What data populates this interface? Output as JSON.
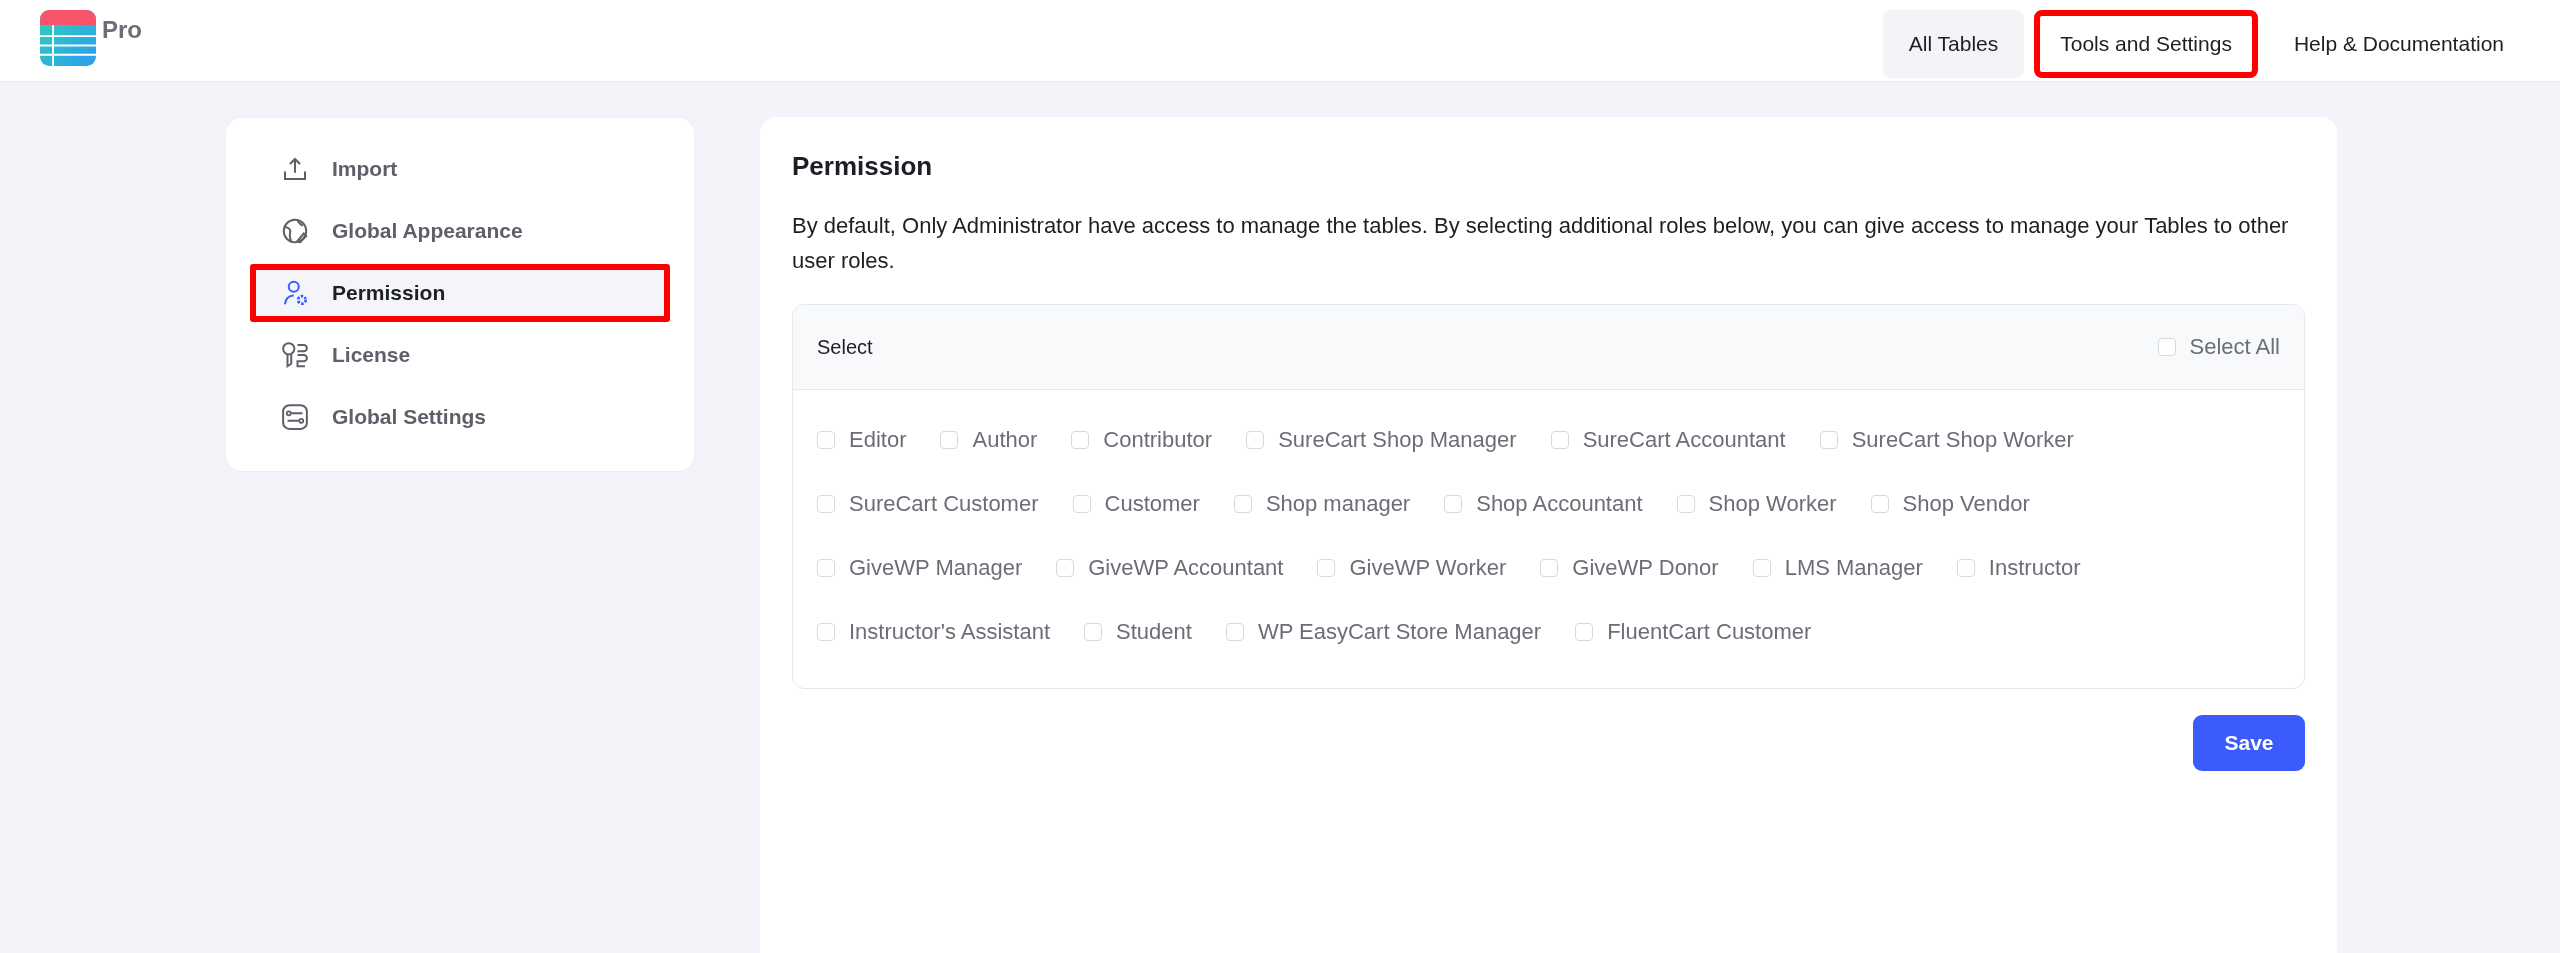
{
  "header": {
    "logo_text": "Pro",
    "nav": [
      {
        "label": "All Tables",
        "selected": true,
        "highlighted": false
      },
      {
        "label": "Tools and Settings",
        "selected": false,
        "highlighted": true
      },
      {
        "label": "Help & Documentation",
        "selected": false,
        "highlighted": false
      }
    ]
  },
  "sidebar": {
    "items": [
      {
        "label": "Import",
        "kind": "import",
        "selected": false,
        "highlighted": false
      },
      {
        "label": "Global Appearance",
        "kind": "appearance",
        "selected": false,
        "highlighted": false
      },
      {
        "label": "Permission",
        "kind": "permission",
        "selected": true,
        "highlighted": true
      },
      {
        "label": "License",
        "kind": "license",
        "selected": false,
        "highlighted": false
      },
      {
        "label": "Global Settings",
        "kind": "settings",
        "selected": false,
        "highlighted": false
      }
    ]
  },
  "panel": {
    "title": "Permission",
    "description": "By default, Only Administrator have access to manage the tables. By selecting additional roles below, you can give access to manage your Tables to other user roles.",
    "select_label": "Select",
    "select_all": {
      "label": "Select All",
      "checked": false
    },
    "role_rows": [
      [
        {
          "label": "Editor",
          "checked": false
        },
        {
          "label": "Author",
          "checked": false
        },
        {
          "label": "Contributor",
          "checked": false
        },
        {
          "label": "SureCart Shop Manager",
          "checked": false
        },
        {
          "label": "SureCart Accountant",
          "checked": false
        },
        {
          "label": "SureCart Shop Worker",
          "checked": false
        }
      ],
      [
        {
          "label": "SureCart Customer",
          "checked": false
        },
        {
          "label": "Customer",
          "checked": false
        },
        {
          "label": "Shop manager",
          "checked": false
        },
        {
          "label": "Shop Accountant",
          "checked": false
        },
        {
          "label": "Shop Worker",
          "checked": false
        },
        {
          "label": "Shop Vendor",
          "checked": false
        }
      ],
      [
        {
          "label": "GiveWP Manager",
          "checked": false
        },
        {
          "label": "GiveWP Accountant",
          "checked": false
        },
        {
          "label": "GiveWP Worker",
          "checked": false
        },
        {
          "label": "GiveWP Donor",
          "checked": false
        },
        {
          "label": "LMS Manager",
          "checked": false
        },
        {
          "label": "Instructor",
          "checked": false
        }
      ],
      [
        {
          "label": "Instructor's Assistant",
          "checked": false
        },
        {
          "label": "Student",
          "checked": false
        },
        {
          "label": "WP EasyCart Store Manager",
          "checked": false
        },
        {
          "label": "FluentCart Customer",
          "checked": false
        }
      ]
    ],
    "save_button": "Save"
  }
}
